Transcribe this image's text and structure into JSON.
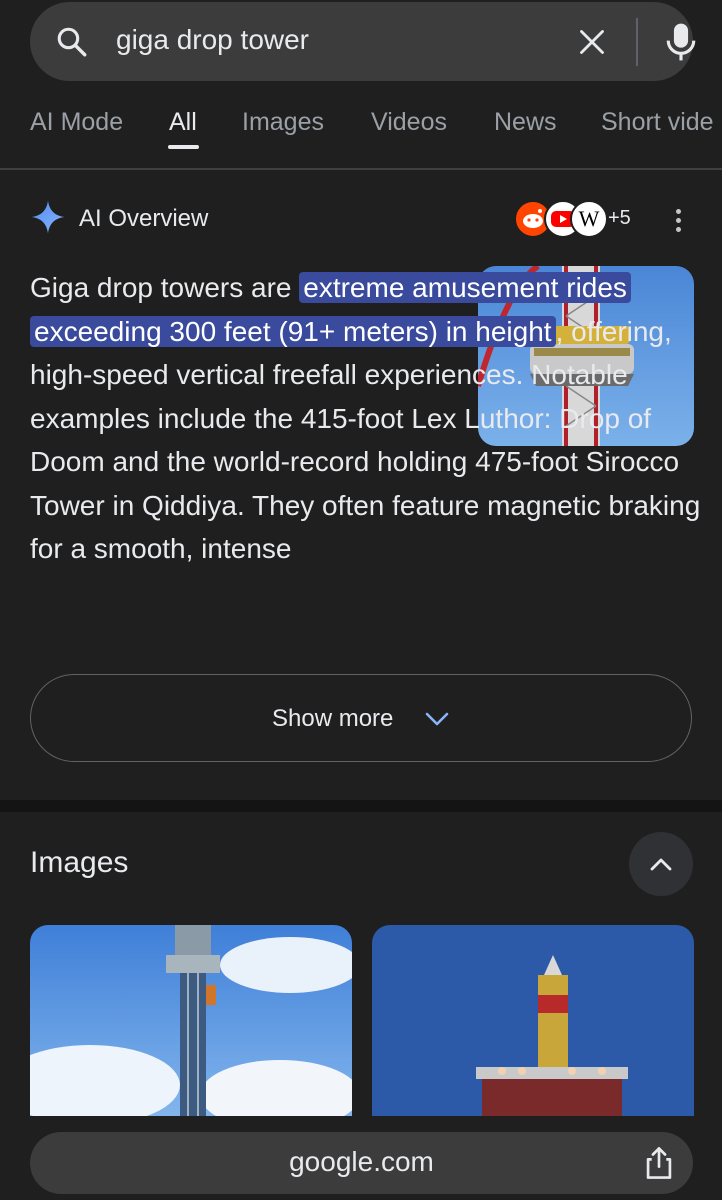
{
  "search": {
    "query": "giga drop tower"
  },
  "tabs": [
    "AI Mode",
    "All",
    "Images",
    "Videos",
    "News",
    "Short vide"
  ],
  "active_tab": "All",
  "ai_overview": {
    "title": "AI Overview",
    "sources_more": "+5",
    "text_before": "Giga drop towers are ",
    "text_highlight": "extreme amusement rides exceeding 300 feet (91+ meters) in height",
    "text_after": ", offering, high-speed vertical freefall experiences. Notable examples include the 415-foot Lex Luthor: Drop of Doom and the world-record holding 475-foot Sirocco Tower in Qiddiya. They often feature magnetic braking for a smooth, intense",
    "show_more": "Show more"
  },
  "images_section": {
    "title": "Images"
  },
  "bottom_bar": {
    "url": "google.com"
  },
  "colors": {
    "background": "#1f1f1f",
    "highlight": "#3a4a9c",
    "search_bg": "#3c3c3c"
  }
}
